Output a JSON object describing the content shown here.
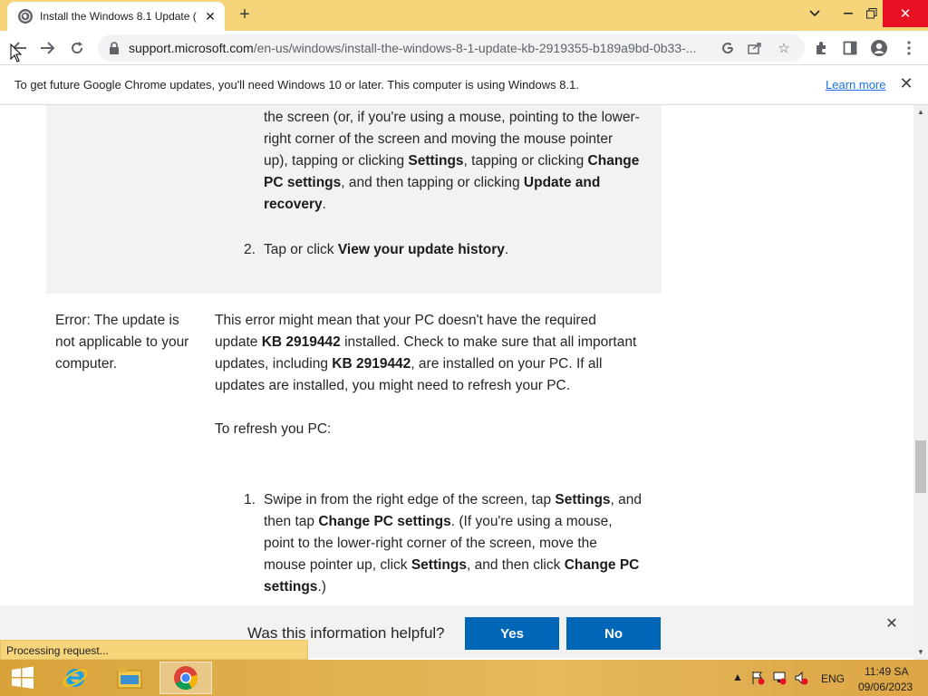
{
  "browser": {
    "tab_title": "Install the Windows 8.1 Update (",
    "url_main": "support.microsoft.com",
    "url_rest": "/en-us/windows/install-the-windows-8-1-update-kb-2919355-b189a9bd-0b33-...",
    "infobar_text": "To get future Google Chrome updates, you'll need Windows 10 or later. This computer is using Windows 8.1.",
    "infobar_link": "Learn more"
  },
  "content": {
    "top_p_1": "the screen (or, if you're using a mouse, pointing to the lower-",
    "top_p_2": "right corner of the screen and moving the mouse pointer",
    "top_p_3a": "up), tapping or clicking ",
    "top_p_3b": "Settings",
    "top_p_3c": ", tapping or clicking ",
    "top_p_3d": "Change",
    "top_p_4a": "PC settings",
    "top_p_4b": ", and then tapping or clicking ",
    "top_p_4c": "Update and",
    "top_p_5a": "recovery",
    "top_p_5b": ".",
    "step2_num": "2.",
    "step2_a": "Tap or click ",
    "step2_b": "View your update history",
    "step2_c": ".",
    "error_label_1": "Error: The update is",
    "error_label_2": "not applicable to your",
    "error_label_3": "computer.",
    "desc_1": "This error might mean that your PC doesn't have the required",
    "desc_2a": "update ",
    "desc_2b": "KB 2919442",
    "desc_2c": " installed. Check to make sure that all important",
    "desc_3a": "updates, including ",
    "desc_3b": "KB 2919442",
    "desc_3c": ", are installed on your PC. If all",
    "desc_4": "updates are installed, you might need to refresh your PC.",
    "refresh_heading": "To refresh you PC:",
    "step1_num": "1.",
    "s1_1a": "Swipe in from the right edge of the screen, tap ",
    "s1_1b": "Settings",
    "s1_1c": ", and",
    "s1_2a": "then tap ",
    "s1_2b": "Change PC settings",
    "s1_2c": ". (If you're using a mouse,",
    "s1_3": "point to the lower-right corner of the screen, move the",
    "s1_4a": "mouse pointer up, click ",
    "s1_4b": "Settings",
    "s1_4c": ", and then click ",
    "s1_4d": "Change PC",
    "s1_5a": "settings",
    "s1_5b": ".)"
  },
  "feedback": {
    "question": "Was this information helpful?",
    "yes": "Yes",
    "no": "No"
  },
  "status_text": "Processing request...",
  "taskbar": {
    "lang": "ENG",
    "time": "11:49 SA",
    "date": "09/06/2023"
  },
  "colors": {
    "accent_button": "#0067b8",
    "chrome_frame": "#f6d47a",
    "close_red": "#e81123"
  }
}
